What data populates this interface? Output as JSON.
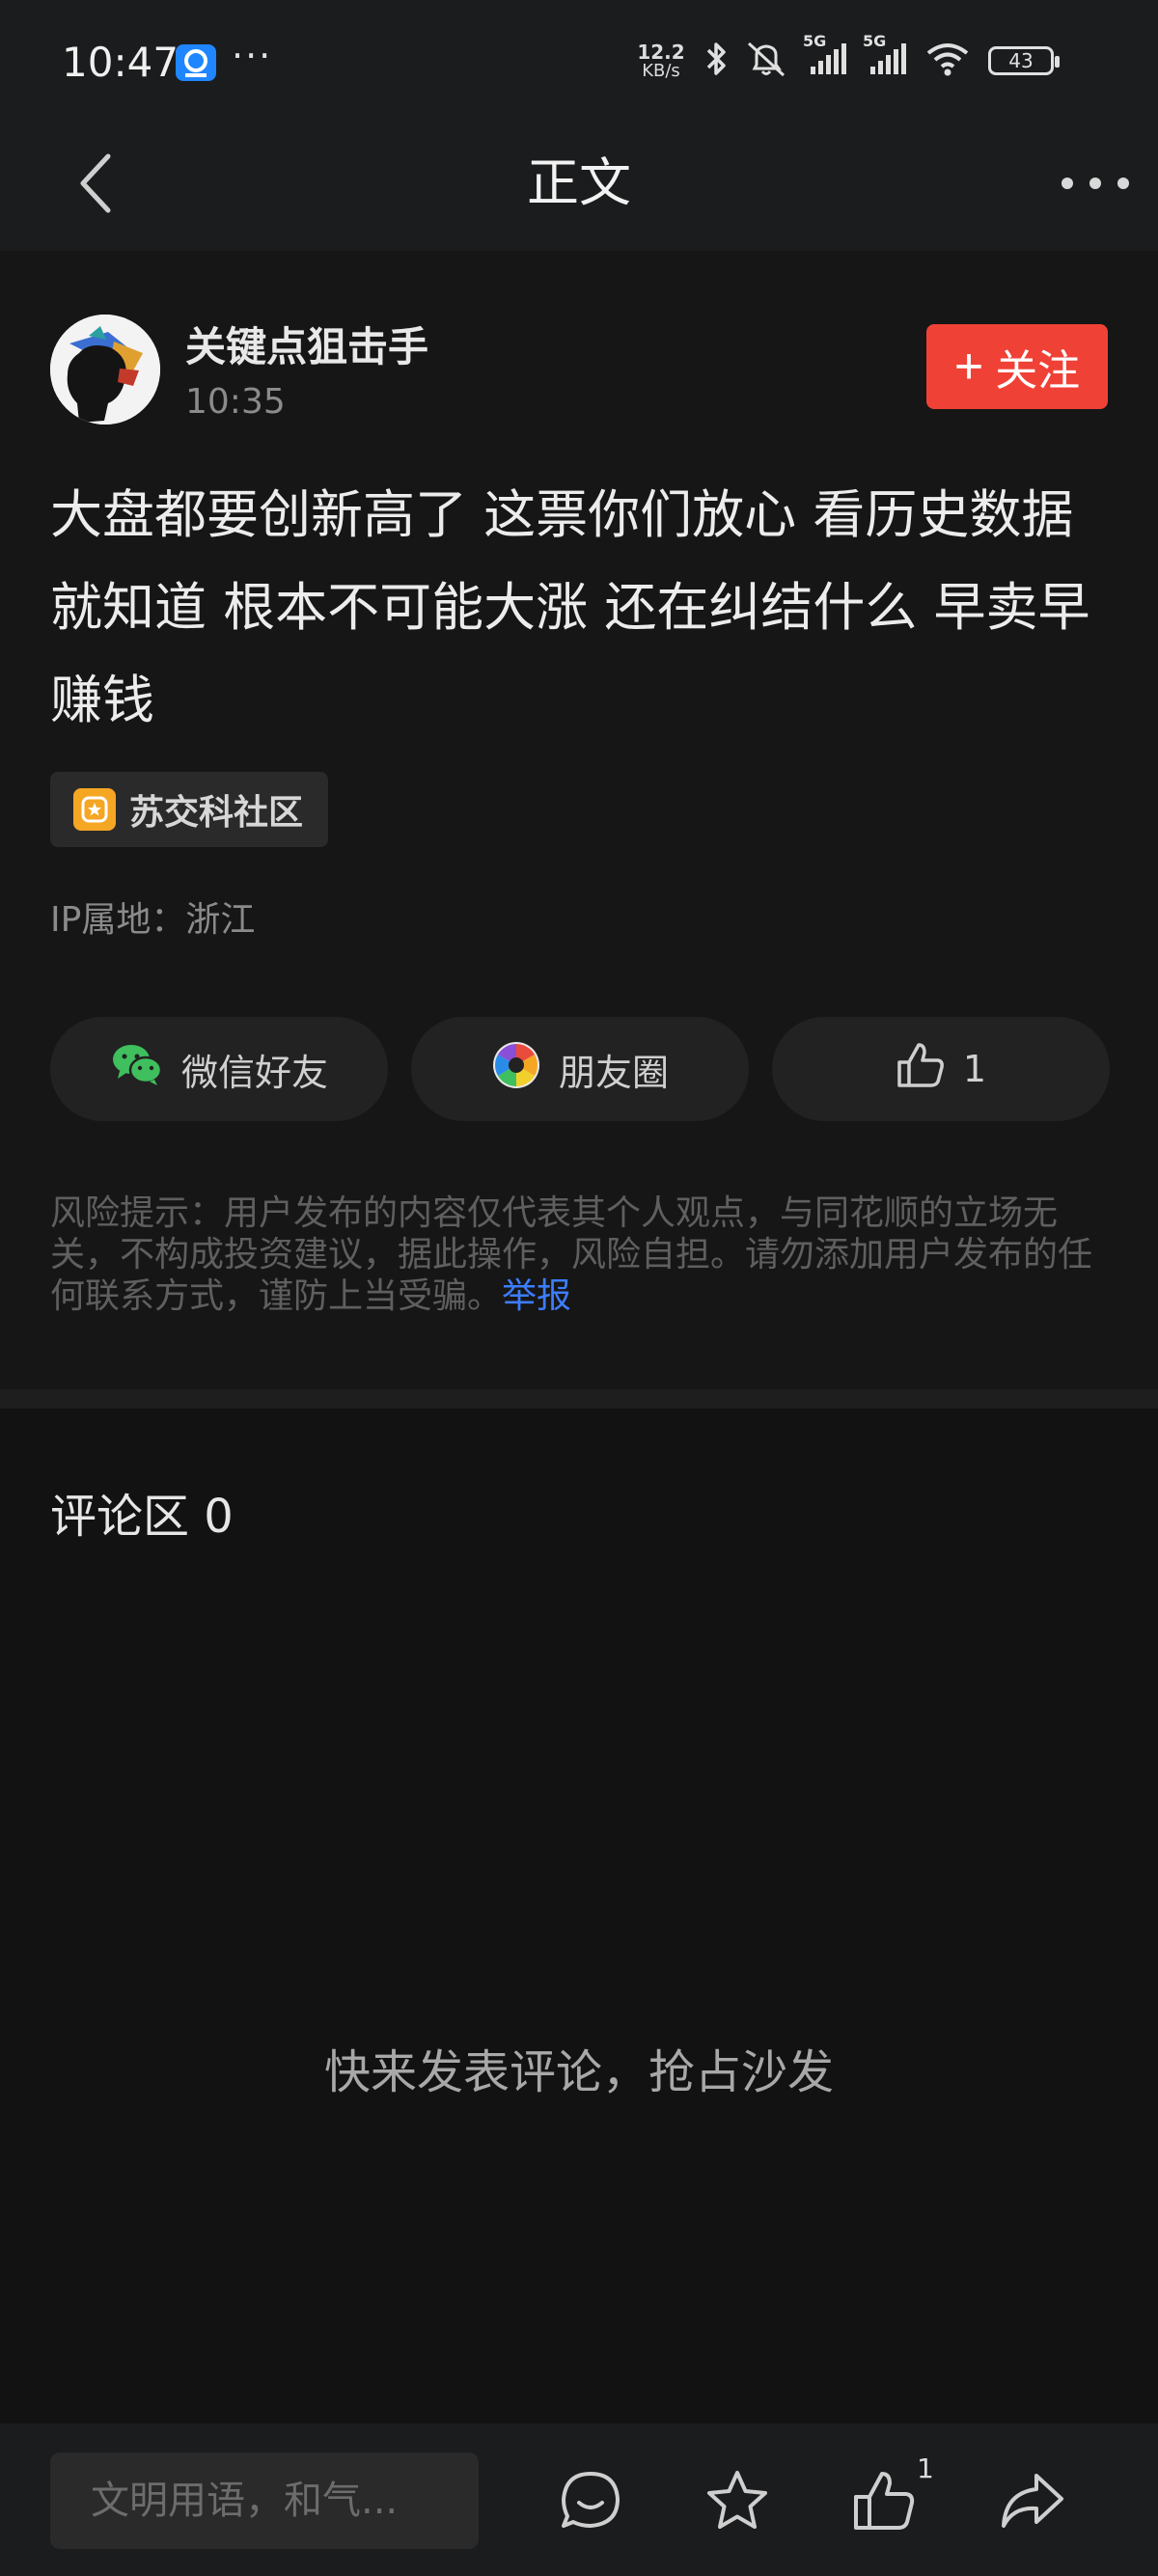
{
  "status_bar": {
    "time": "10:47",
    "more": "···",
    "net_speed_value": "12.2",
    "net_speed_unit": "KB/s",
    "signal_1": "5G",
    "signal_2": "5G",
    "battery": "43",
    "icons": [
      "app-icon",
      "bluetooth-icon",
      "mute-icon",
      "signal-icon",
      "signal-icon",
      "wifi-icon",
      "battery-icon"
    ]
  },
  "header": {
    "title": "正文",
    "back_icon": "chevron-left-icon",
    "more_icon": "more-horizontal-icon"
  },
  "post": {
    "author": "关键点狙击手",
    "time": "10:35",
    "follow_label": "关注",
    "follow_plus": "+",
    "content": "大盘都要创新高了 这票你们放心 看历史数据就知道 根本不可能大涨 还在纠结什么 早卖早赚钱",
    "community": "苏交科社区",
    "ip_location": "IP属地：浙江"
  },
  "share": {
    "wechat": "微信好友",
    "moments": "朋友圈",
    "like_count": "1"
  },
  "risk": {
    "text": "风险提示：用户发布的内容仅代表其个人观点，与同花顺的立场无关，不构成投资建议，据此操作，风险自担。请勿添加用户发布的任何联系方式，谨防上当受骗。",
    "report": "举报"
  },
  "comments": {
    "title": "评论区 0",
    "empty_text": "快来发表评论，抢占沙发"
  },
  "bottom_bar": {
    "input_placeholder": "文明用语，和气...",
    "like_badge": "1"
  },
  "colors": {
    "accent_red": "#f04136",
    "link_blue": "#3d7dff",
    "background": "#121212"
  }
}
